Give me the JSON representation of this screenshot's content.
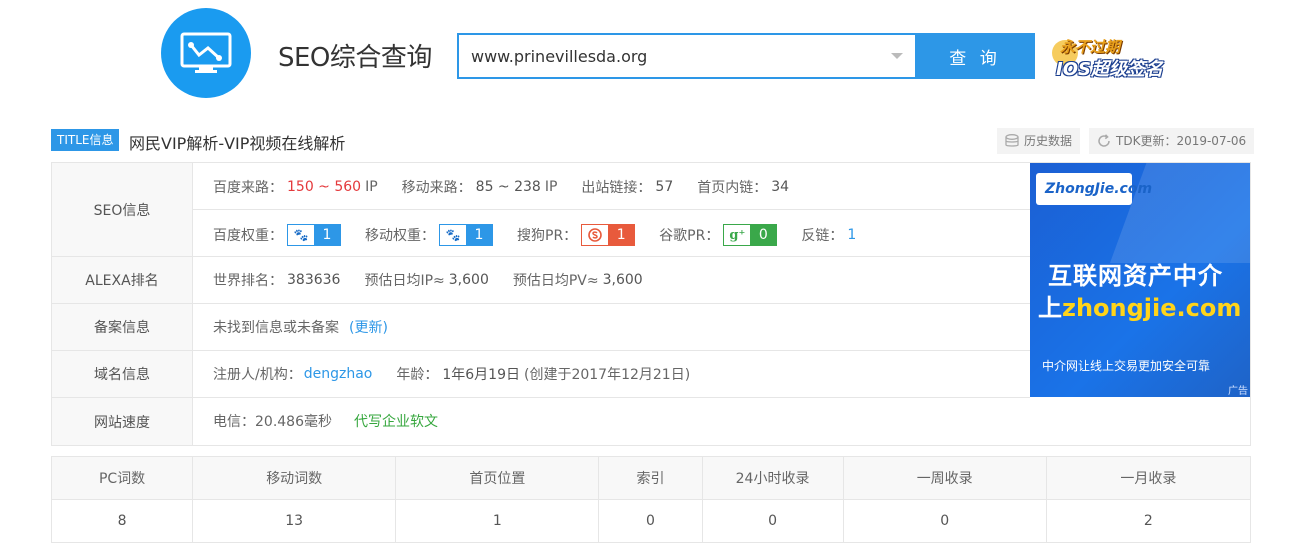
{
  "header": {
    "site_title": "SEO综合查询",
    "search_value": "www.prinevillesda.org",
    "search_button": "查 询",
    "promo_line1": "永不过期",
    "promo_line2": "IOS超级签名",
    "accent_color": "#2d97e7"
  },
  "title_bar": {
    "tag": "TITLE信息",
    "title": "网民VIP解析-VIP视频在线解析",
    "history": "历史数据",
    "tdk": "TDK更新：2019-07-06"
  },
  "seo": {
    "label": "SEO信息",
    "baidu_traffic_label": "百度来路：",
    "baidu_traffic_value": "150 ~ 560",
    "ip_unit": "IP",
    "mobile_traffic_label": "移动来路：",
    "mobile_traffic_value": "85 ~ 238",
    "mobile_ip_unit": "IP",
    "outbound_label": "出站链接：",
    "outbound_value": "57",
    "internal_label": "首页内链：",
    "internal_value": "34",
    "baidu_weight_label": "百度权重：",
    "baidu_weight_value": "1",
    "mobile_weight_label": "移动权重：",
    "mobile_weight_value": "1",
    "sogou_label": "搜狗PR：",
    "sogou_value": "1",
    "google_label": "谷歌PR：",
    "google_value": "0",
    "backlink_label": "反链：",
    "backlink_value": "1"
  },
  "alexa": {
    "label": "ALEXA排名",
    "world_rank_label": "世界排名：",
    "world_rank": "383636",
    "ip_label": "预估日均IP≈",
    "ip_value": "3,600",
    "pv_label": "预估日均PV≈",
    "pv_value": "3,600"
  },
  "icp": {
    "label": "备案信息",
    "text": "未找到信息或未备案",
    "update": "(更新)"
  },
  "domain": {
    "label": "域名信息",
    "registrant_label": "注册人/机构：",
    "registrant": "dengzhao",
    "age_label": "年龄：",
    "age": "1年6月19日",
    "created": "(创建于2017年12月21日)"
  },
  "speed": {
    "label": "网站速度",
    "telecom": "电信：20.486毫秒",
    "ad_link": "代写企业软文"
  },
  "ad": {
    "logo": "ZhongJie.com",
    "line1": "互联网资产中介",
    "line2_prefix": "上",
    "line2_domain": "zhongjie.com",
    "sub": "中介网让线上交易更加安全可靠",
    "mark": "广告"
  },
  "stats": {
    "headers": [
      "PC词数",
      "移动词数",
      "首页位置",
      "索引",
      "24小时收录",
      "一周收录",
      "一月收录"
    ],
    "values": [
      "8",
      "13",
      "1",
      "0",
      "0",
      "0",
      "2"
    ]
  }
}
